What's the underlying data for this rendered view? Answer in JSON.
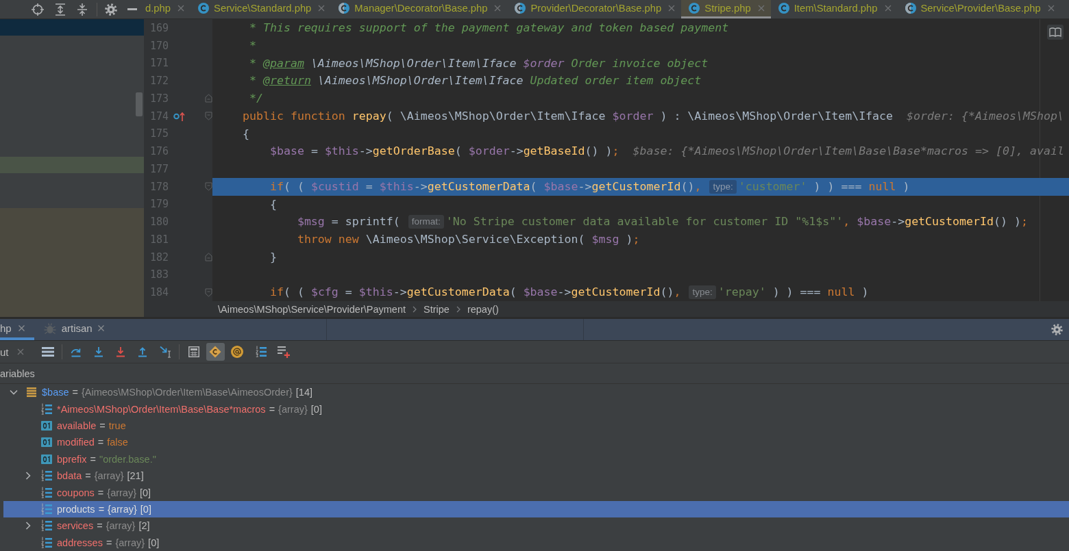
{
  "editor_tabs": [
    {
      "label": "d.php",
      "kind": "none",
      "selected": false
    },
    {
      "label": "Service\\Standard.php",
      "kind": "class",
      "selected": false
    },
    {
      "label": "Manager\\Decorator\\Base.php",
      "kind": "abstract_class",
      "selected": false
    },
    {
      "label": "Provider\\Decorator\\Base.php",
      "kind": "abstract_class",
      "selected": false
    },
    {
      "label": "Stripe.php",
      "kind": "class",
      "selected": true
    },
    {
      "label": "Item\\Standard.php",
      "kind": "class",
      "selected": false
    },
    {
      "label": "Service\\Provider\\Base.php",
      "kind": "abstract_class",
      "selected": false
    }
  ],
  "editor": {
    "lines": [
      {
        "number": "169",
        "highlighted": false,
        "override_marker": false,
        "segments": [
          {
            "kind": "code",
            "tokens": [
              {
                "kind": "comment",
                "text": "     * This requires support of the payment gateway and token based payment"
              }
            ]
          }
        ]
      },
      {
        "number": "170",
        "highlighted": false,
        "override_marker": false,
        "segments": [
          {
            "kind": "code",
            "tokens": [
              {
                "kind": "comment",
                "text": "     *"
              }
            ]
          }
        ]
      },
      {
        "number": "171",
        "highlighted": false,
        "override_marker": false,
        "segments": [
          {
            "kind": "code",
            "tokens": [
              {
                "kind": "comment",
                "text": "     * "
              },
              {
                "kind": "doc_tag",
                "text": "@param"
              },
              {
                "kind": "doc_type",
                "text": " \\Aimeos\\MShop\\Order\\Item\\Iface"
              },
              {
                "kind": "doc_var",
                "text": " $order"
              },
              {
                "kind": "comment",
                "text": " Order invoice object"
              }
            ]
          }
        ]
      },
      {
        "number": "172",
        "highlighted": false,
        "override_marker": false,
        "segments": [
          {
            "kind": "code",
            "tokens": [
              {
                "kind": "comment",
                "text": "     * "
              },
              {
                "kind": "doc_tag",
                "text": "@return"
              },
              {
                "kind": "doc_type",
                "text": " \\Aimeos\\MShop\\Order\\Item\\Iface"
              },
              {
                "kind": "comment",
                "text": " Updated order item object"
              }
            ]
          }
        ]
      },
      {
        "number": "173",
        "highlighted": false,
        "override_marker": false,
        "fold_marker": {
          "kind": "end"
        },
        "segments": [
          {
            "kind": "code",
            "tokens": [
              {
                "kind": "comment",
                "text": "     */"
              }
            ]
          }
        ]
      },
      {
        "number": "174",
        "highlighted": false,
        "override_marker": true,
        "fold_marker": {
          "kind": "start"
        },
        "segments": [
          {
            "kind": "code",
            "tokens": [
              {
                "kind": "keyword",
                "text": "    public function "
              },
              {
                "kind": "function",
                "text": "repay"
              },
              {
                "kind": "plain",
                "text": "( \\Aimeos\\MShop\\Order\\Item\\Iface "
              },
              {
                "kind": "variable",
                "text": "$order"
              },
              {
                "kind": "plain",
                "text": " ) : \\Aimeos\\MShop\\Order\\Item\\Iface"
              }
            ]
          },
          {
            "kind": "value_hint",
            "text": "$order: {*Aimeos\\MShop\\"
          }
        ]
      },
      {
        "number": "175",
        "highlighted": false,
        "override_marker": false,
        "segments": [
          {
            "kind": "code",
            "tokens": [
              {
                "kind": "plain",
                "text": "    {"
              }
            ]
          }
        ]
      },
      {
        "number": "176",
        "highlighted": false,
        "override_marker": false,
        "segments": [
          {
            "kind": "code",
            "tokens": [
              {
                "kind": "variable",
                "text": "        $base"
              },
              {
                "kind": "plain",
                "text": " = "
              },
              {
                "kind": "variable",
                "text": "$this"
              },
              {
                "kind": "plain",
                "text": "->"
              },
              {
                "kind": "function",
                "text": "getOrderBase"
              },
              {
                "kind": "plain",
                "text": "( "
              },
              {
                "kind": "variable",
                "text": "$order"
              },
              {
                "kind": "plain",
                "text": "->"
              },
              {
                "kind": "function",
                "text": "getBaseId"
              },
              {
                "kind": "plain",
                "text": "() )"
              },
              {
                "kind": "punct",
                "text": ";"
              }
            ]
          },
          {
            "kind": "value_hint",
            "text": "$base: {*Aimeos\\MShop\\Order\\Item\\Base\\Base*macros => [0], avail"
          }
        ]
      },
      {
        "number": "177",
        "highlighted": false,
        "override_marker": false
      },
      {
        "number": "178",
        "highlighted": true,
        "override_marker": false,
        "fold_marker": {
          "kind": "start"
        },
        "segments": [
          {
            "kind": "code",
            "tokens": [
              {
                "kind": "keyword",
                "text": "        if"
              },
              {
                "kind": "plain",
                "text": "( ( "
              },
              {
                "kind": "variable",
                "text": "$custid"
              },
              {
                "kind": "plain",
                "text": " = "
              },
              {
                "kind": "variable",
                "text": "$this"
              },
              {
                "kind": "plain",
                "text": "->"
              },
              {
                "kind": "function",
                "text": "getCustomerData"
              },
              {
                "kind": "plain",
                "text": "( "
              },
              {
                "kind": "variable",
                "text": "$base"
              },
              {
                "kind": "plain",
                "text": "->"
              },
              {
                "kind": "function",
                "text": "getCustomerId"
              },
              {
                "kind": "plain",
                "text": "()"
              },
              {
                "kind": "punct",
                "text": ","
              }
            ]
          },
          {
            "kind": "param_hint",
            "text": "type:"
          },
          {
            "kind": "code",
            "tokens": [
              {
                "kind": "string",
                "text": "'customer'"
              },
              {
                "kind": "plain",
                "text": " ) ) === "
              },
              {
                "kind": "keyword",
                "text": "null"
              },
              {
                "kind": "plain",
                "text": " )"
              }
            ]
          }
        ]
      },
      {
        "number": "179",
        "highlighted": false,
        "override_marker": false,
        "segments": [
          {
            "kind": "code",
            "tokens": [
              {
                "kind": "plain",
                "text": "        {"
              }
            ]
          }
        ]
      },
      {
        "number": "180",
        "highlighted": false,
        "override_marker": false,
        "segments": [
          {
            "kind": "code",
            "tokens": [
              {
                "kind": "variable",
                "text": "            $msg"
              },
              {
                "kind": "plain",
                "text": " = sprintf("
              }
            ]
          },
          {
            "kind": "param_hint",
            "text": "format:"
          },
          {
            "kind": "code",
            "tokens": [
              {
                "kind": "string",
                "text": "'No Stripe customer data available for customer ID \"%1$s\"'"
              },
              {
                "kind": "punct",
                "text": ", "
              },
              {
                "kind": "variable",
                "text": "$base"
              },
              {
                "kind": "plain",
                "text": "->"
              },
              {
                "kind": "function",
                "text": "getCustomerId"
              },
              {
                "kind": "plain",
                "text": "() )"
              },
              {
                "kind": "punct",
                "text": ";"
              }
            ]
          }
        ]
      },
      {
        "number": "181",
        "highlighted": false,
        "override_marker": false,
        "segments": [
          {
            "kind": "code",
            "tokens": [
              {
                "kind": "keyword",
                "text": "            throw new"
              },
              {
                "kind": "plain",
                "text": " \\Aimeos\\MShop\\Service\\Exception( "
              },
              {
                "kind": "variable",
                "text": "$msg"
              },
              {
                "kind": "plain",
                "text": " )"
              },
              {
                "kind": "punct",
                "text": ";"
              }
            ]
          }
        ]
      },
      {
        "number": "182",
        "highlighted": false,
        "override_marker": false,
        "fold_marker": {
          "kind": "end"
        },
        "segments": [
          {
            "kind": "code",
            "tokens": [
              {
                "kind": "plain",
                "text": "        }"
              }
            ]
          }
        ]
      },
      {
        "number": "183",
        "highlighted": false,
        "override_marker": false
      },
      {
        "number": "184",
        "highlighted": false,
        "override_marker": false,
        "fold_marker": {
          "kind": "start"
        },
        "segments": [
          {
            "kind": "code",
            "tokens": [
              {
                "kind": "keyword",
                "text": "        if"
              },
              {
                "kind": "plain",
                "text": "( ( "
              },
              {
                "kind": "variable",
                "text": "$cfg"
              },
              {
                "kind": "plain",
                "text": " = "
              },
              {
                "kind": "variable",
                "text": "$this"
              },
              {
                "kind": "plain",
                "text": "->"
              },
              {
                "kind": "function",
                "text": "getCustomerData"
              },
              {
                "kind": "plain",
                "text": "( "
              },
              {
                "kind": "variable",
                "text": "$base"
              },
              {
                "kind": "plain",
                "text": "->"
              },
              {
                "kind": "function",
                "text": "getCustomerId"
              },
              {
                "kind": "plain",
                "text": "()"
              },
              {
                "kind": "punct",
                "text": ","
              }
            ]
          },
          {
            "kind": "param_hint",
            "text": "type:"
          },
          {
            "kind": "code",
            "tokens": [
              {
                "kind": "string",
                "text": "'repay'"
              },
              {
                "kind": "plain",
                "text": " ) ) === "
              },
              {
                "kind": "keyword",
                "text": "null"
              },
              {
                "kind": "plain",
                "text": " )"
              }
            ]
          }
        ]
      }
    ],
    "breadcrumb": [
      "\\Aimeos\\MShop\\Service\\Provider\\Payment",
      "Stripe",
      "repay()"
    ]
  },
  "debug_tabs": [
    {
      "label": "hp",
      "kind": "plain",
      "selected": true
    },
    {
      "label": "artisan",
      "kind": "with_icon",
      "selected": false
    }
  ],
  "debug_toolbar": {
    "tab": {
      "label": "ut"
    },
    "toggles": [
      {
        "on": true
      },
      {
        "on": false
      }
    ]
  },
  "variables": {
    "title": "ariables",
    "tree": [
      {
        "kind": "object",
        "expanded": true,
        "selected": false,
        "parts": [
          {
            "kind": "variable",
            "text": "$base"
          },
          {
            "kind": "operator",
            "text": "="
          },
          {
            "kind": "type",
            "text": "{Aimeos\\MShop\\Order\\Item\\Base\\AimeosOrder}"
          },
          {
            "kind": "value",
            "text": "[14]"
          }
        ],
        "children": [
          {
            "kind": "array",
            "selected": false,
            "parts": [
              {
                "kind": "field",
                "text": "*Aimeos\\MShop\\Order\\Item\\Base\\Base*macros"
              },
              {
                "kind": "operator",
                "text": "="
              },
              {
                "kind": "type",
                "text": "{array}"
              },
              {
                "kind": "value",
                "text": "[0]"
              }
            ]
          },
          {
            "kind": "scalar",
            "selected": false,
            "parts": [
              {
                "kind": "field",
                "text": "available"
              },
              {
                "kind": "operator",
                "text": "="
              },
              {
                "kind": "keyword",
                "text": "true"
              }
            ]
          },
          {
            "kind": "scalar",
            "selected": false,
            "parts": [
              {
                "kind": "field",
                "text": "modified"
              },
              {
                "kind": "operator",
                "text": "="
              },
              {
                "kind": "keyword",
                "text": "false"
              }
            ]
          },
          {
            "kind": "scalar",
            "selected": false,
            "parts": [
              {
                "kind": "field",
                "text": "bprefix"
              },
              {
                "kind": "operator",
                "text": "="
              },
              {
                "kind": "string",
                "text": "\"order.base.\""
              }
            ]
          },
          {
            "kind": "array",
            "expanded": false,
            "selected": false,
            "parts": [
              {
                "kind": "field",
                "text": "bdata"
              },
              {
                "kind": "operator",
                "text": "="
              },
              {
                "kind": "type",
                "text": "{array}"
              },
              {
                "kind": "value",
                "text": "[21]"
              }
            ]
          },
          {
            "kind": "array",
            "selected": false,
            "parts": [
              {
                "kind": "field",
                "text": "coupons"
              },
              {
                "kind": "operator",
                "text": "="
              },
              {
                "kind": "type",
                "text": "{array}"
              },
              {
                "kind": "value",
                "text": "[0]"
              }
            ]
          },
          {
            "kind": "array",
            "selected": true,
            "parts": [
              {
                "kind": "field",
                "text": "products"
              },
              {
                "kind": "operator",
                "text": "="
              },
              {
                "kind": "type",
                "text": "{array}"
              },
              {
                "kind": "value",
                "text": "[0]"
              }
            ]
          },
          {
            "kind": "array",
            "expanded": false,
            "selected": false,
            "parts": [
              {
                "kind": "field",
                "text": "services"
              },
              {
                "kind": "operator",
                "text": "="
              },
              {
                "kind": "type",
                "text": "{array}"
              },
              {
                "kind": "value",
                "text": "[2]"
              }
            ]
          },
          {
            "kind": "array",
            "selected": false,
            "parts": [
              {
                "kind": "field",
                "text": "addresses"
              },
              {
                "kind": "operator",
                "text": "="
              },
              {
                "kind": "type",
                "text": "{array}"
              },
              {
                "kind": "value",
                "text": "[0]"
              }
            ]
          }
        ]
      }
    ]
  }
}
